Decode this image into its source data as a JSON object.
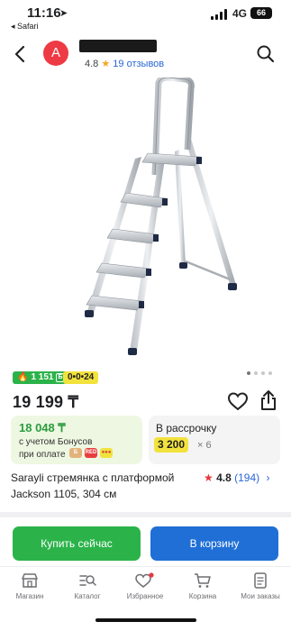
{
  "status_bar": {
    "time": "11:16",
    "location_glyph": "➤",
    "back_app": "◂ Safari",
    "network": "4G",
    "battery": "66"
  },
  "header": {
    "seller_initial": "A",
    "seller_rating": "4.8",
    "seller_reviews": "19 отзывов"
  },
  "badges": {
    "bonus": "1 151",
    "bonus_icon": "Б",
    "installment": "0•0•24"
  },
  "price": "19 199 ₸",
  "bonus_card": {
    "amount": "18 048 ₸",
    "line1": "с учетом Бонусов",
    "line2": "при оплате",
    "pay_icons": [
      "Б",
      "RED",
      "●●●"
    ]
  },
  "installment_card": {
    "label": "В рассрочку",
    "amount": "3 200",
    "multiplier": "× 6"
  },
  "product": {
    "title": "Sarayli стремянка с платформой Jackson 1105, 304 см",
    "rating": "4.8",
    "reviews": "(194)"
  },
  "actions": {
    "buy": "Купить сейчас",
    "cart": "В корзину"
  },
  "tabs": [
    {
      "label": "Магазин",
      "icon": "store-icon"
    },
    {
      "label": "Каталог",
      "icon": "catalog-icon"
    },
    {
      "label": "Избранное",
      "icon": "heart-icon"
    },
    {
      "label": "Корзина",
      "icon": "cart-icon"
    },
    {
      "label": "Мои заказы",
      "icon": "orders-icon"
    }
  ],
  "colors": {
    "green": "#2bb34a",
    "blue": "#1f6fd6",
    "yellow": "#f2e23c",
    "red": "#ee3a44"
  }
}
